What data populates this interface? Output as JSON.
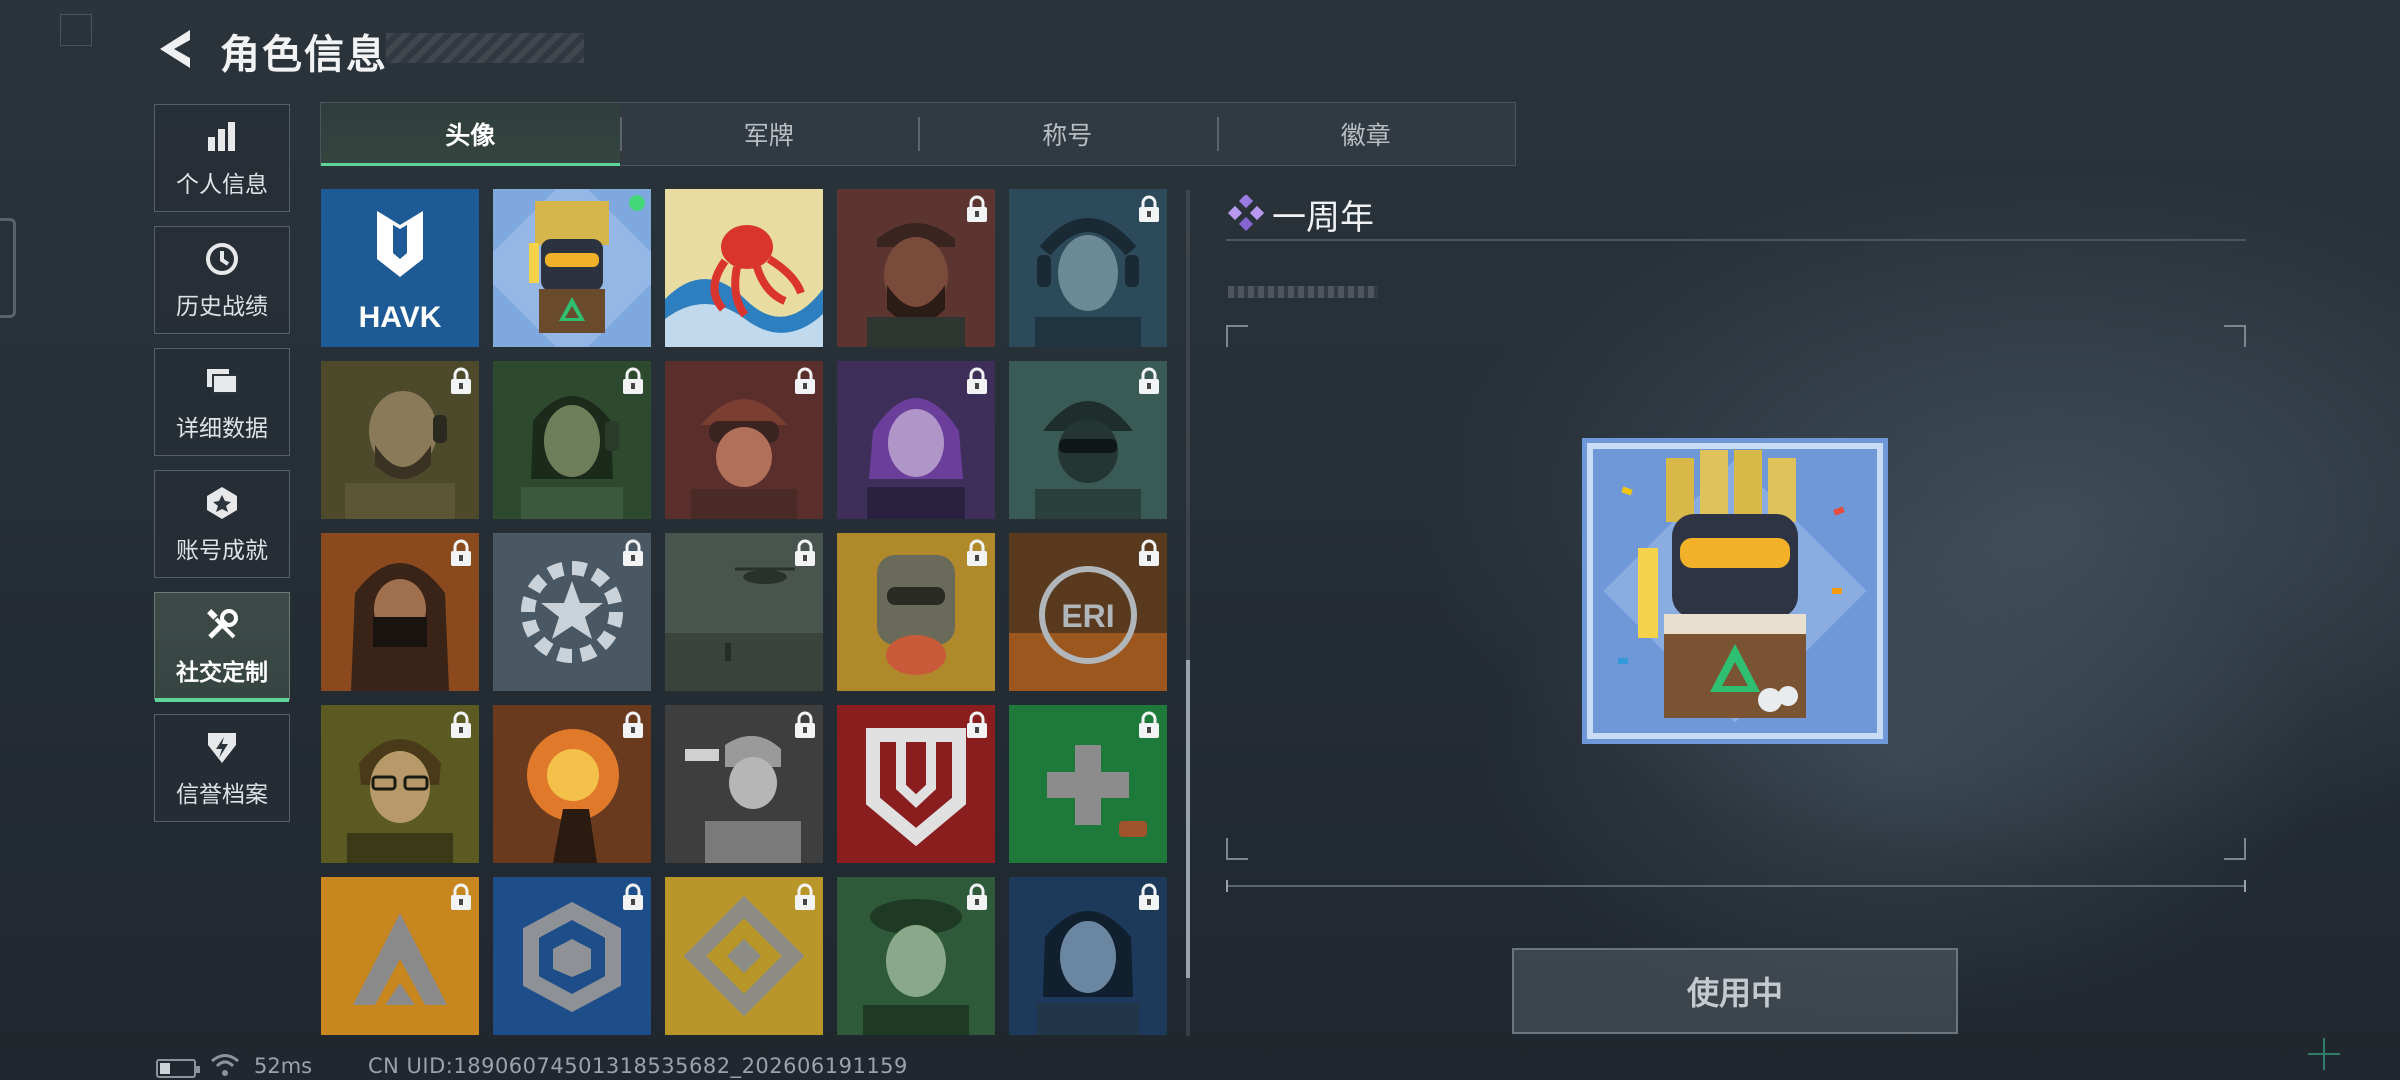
{
  "header": {
    "title": "角色信息"
  },
  "sidebar": {
    "items": [
      {
        "label": "个人信息",
        "icon": "bar-chart-icon",
        "active": false
      },
      {
        "label": "历史战绩",
        "icon": "history-clock-icon",
        "active": false
      },
      {
        "label": "详细数据",
        "icon": "folder-icon",
        "active": false
      },
      {
        "label": "账号成就",
        "icon": "achievement-badge-icon",
        "active": false
      },
      {
        "label": "社交定制",
        "icon": "wrench-screwdriver-icon",
        "active": true
      },
      {
        "label": "信誉档案",
        "icon": "shield-bolt-icon",
        "active": false
      }
    ]
  },
  "tabs": [
    {
      "label": "头像",
      "active": true
    },
    {
      "label": "军牌",
      "active": false
    },
    {
      "label": "称号",
      "active": false
    },
    {
      "label": "徽章",
      "active": false
    }
  ],
  "avatars": [
    {
      "name": "havk-logo",
      "text": "HAVK",
      "locked": false
    },
    {
      "name": "anniversary-mascot",
      "locked": false,
      "selected": true,
      "in_use": true
    },
    {
      "name": "octopus-wave",
      "locked": false
    },
    {
      "name": "bearded-operator-cap",
      "locked": true
    },
    {
      "name": "pilot-headset",
      "locked": true
    },
    {
      "name": "bald-operator-headset",
      "locked": true
    },
    {
      "name": "longhair-operator-headset",
      "locked": true
    },
    {
      "name": "helmet-goggles-operator",
      "locked": true
    },
    {
      "name": "purple-hair-operator",
      "locked": true
    },
    {
      "name": "masked-helmet-operator",
      "locked": true
    },
    {
      "name": "hooded-masked-operator",
      "locked": true
    },
    {
      "name": "star-gear-emblem",
      "locked": true
    },
    {
      "name": "helicopter-battlefield",
      "locked": true
    },
    {
      "name": "fist-character",
      "locked": true
    },
    {
      "name": "eri-globe-emblem",
      "text": "ERI",
      "locked": true
    },
    {
      "name": "glasses-operator",
      "locked": true
    },
    {
      "name": "explosion-hand",
      "locked": true
    },
    {
      "name": "pistol-soldier-sketch",
      "locked": true
    },
    {
      "name": "red-shield-emblem",
      "locked": true
    },
    {
      "name": "green-medic-cross",
      "locked": true
    },
    {
      "name": "orange-triangle-emblem",
      "locked": true
    },
    {
      "name": "blue-hex-emblem",
      "locked": true
    },
    {
      "name": "yellow-diamond-emblem",
      "locked": true
    },
    {
      "name": "green-beret-woman",
      "locked": true
    },
    {
      "name": "blue-longhair-man",
      "locked": true
    }
  ],
  "detail": {
    "name": "一周年",
    "button_label": "使用中"
  },
  "status": {
    "ping": "52ms",
    "uid": "CN UID:1890607450131853568​2_202606191159"
  },
  "colors": {
    "accent": "#5fd39a",
    "diamond": "#9a7be0",
    "background": "#262e36"
  }
}
